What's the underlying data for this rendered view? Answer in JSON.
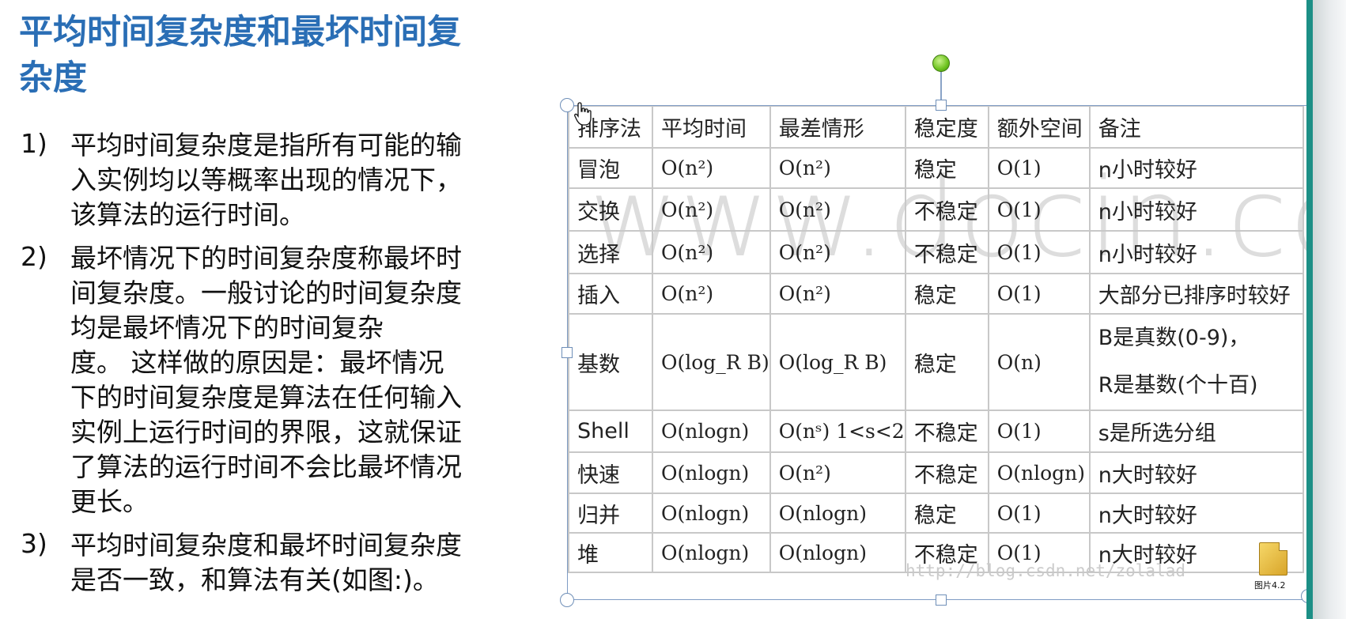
{
  "slide": {
    "title_lines": [
      "平均时间复杂度和最坏时间复",
      "杂度"
    ],
    "bullets": [
      {
        "num": "1)",
        "lines": [
          "平均时间复杂度是指所有可能的输",
          "入实例均以等概率出现的情况下，",
          "该算法的运行时间。"
        ]
      },
      {
        "num": "2)",
        "lines": [
          "最坏情况下的时间复杂度称最坏时",
          "间复杂度。一般讨论的时间复杂度",
          "均是最坏情况下的时间复杂",
          "度。 这样做的原因是：最坏情况",
          "下的时间复杂度是算法在任何输入",
          "实例上运行时间的界限，这就保证",
          "了算法的运行时间不会比最坏情况",
          "更长。"
        ]
      },
      {
        "num": "3)",
        "lines": [
          "平均时间复杂度和最坏时间复杂度",
          "是否一致，和算法有关(如图:)。"
        ]
      }
    ]
  },
  "table": {
    "headers": [
      "排序法",
      "平均时间",
      "最差情形",
      "稳定度",
      "额外空间",
      "备注"
    ],
    "rows": [
      {
        "name": "冒泡",
        "avg": "O(n²)",
        "worst": "O(n²)",
        "stability": "稳定",
        "space": "O(1)",
        "note": [
          "n小时较好"
        ]
      },
      {
        "name": "交换",
        "avg": "O(n²)",
        "worst": "O(n²)",
        "stability": "不稳定",
        "space": "O(1)",
        "note": [
          "n小时较好"
        ]
      },
      {
        "name": "选择",
        "avg": "O(n²)",
        "worst": "O(n²)",
        "stability": "不稳定",
        "space": "O(1)",
        "note": [
          "n小时较好"
        ]
      },
      {
        "name": "插入",
        "avg": "O(n²)",
        "worst": "O(n²)",
        "stability": "稳定",
        "space": "O(1)",
        "note": [
          "大部分已排序时较好"
        ]
      },
      {
        "name": "基数",
        "avg": "O(log_R B)",
        "worst": "O(log_R B)",
        "stability": "稳定",
        "space": "O(n)",
        "note": [
          "B是真数(0-9)，",
          "R是基数(个十百)"
        ]
      },
      {
        "name": "Shell",
        "avg": "O(nlogn)",
        "worst": "O(nˢ) 1<s<2",
        "stability": "不稳定",
        "space": "O(1)",
        "note": [
          "s是所选分组"
        ]
      },
      {
        "name": "快速",
        "avg": "O(nlogn)",
        "worst": "O(n²)",
        "stability": "不稳定",
        "space": "O(nlogn)",
        "note": [
          "n大时较好"
        ]
      },
      {
        "name": "归并",
        "avg": "O(nlogn)",
        "worst": "O(nlogn)",
        "stability": "稳定",
        "space": "O(1)",
        "note": [
          "n大时较好"
        ]
      },
      {
        "name": "堆",
        "avg": "O(nlogn)",
        "worst": "O(nlogn)",
        "stability": "不稳定",
        "space": "O(1)",
        "note": [
          "n大时较好"
        ]
      }
    ]
  },
  "watermark": {
    "text": "www.docin.co",
    "url": "http://blog.csdn.net/zolalad"
  },
  "file_icon": {
    "label": "图片4.2",
    "icon": "folder-icon"
  }
}
